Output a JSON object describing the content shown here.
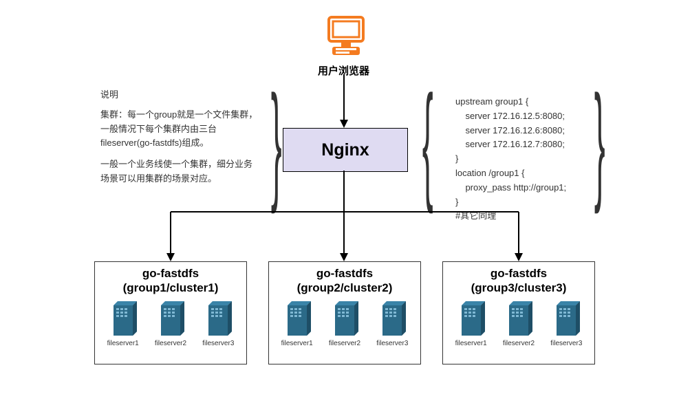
{
  "top": {
    "browser_label": "用户浏览器"
  },
  "nginx": {
    "label": "Nginx"
  },
  "note_left": {
    "title": "说明",
    "p1": "集群：每一个group就是一个文件集群，一般情况下每个集群内由三台fileserver(go-fastdfs)组成。",
    "p2": "一般一个业务线使一个集群，细分业务场景可以用集群的场景对应。"
  },
  "note_right": {
    "line1": "upstream group1 {",
    "line2": "    server 172.16.12.5:8080;",
    "line3": "    server 172.16.12.6:8080;",
    "line4": "    server 172.16.12.7:8080;",
    "line5": "}",
    "line6": "location /group1 {",
    "line7": "    proxy_pass http://group1;",
    "line8": "}",
    "line9": "#其它同理"
  },
  "clusters": [
    {
      "title_l1": "go-fastdfs",
      "title_l2": "(group1/cluster1)",
      "servers": [
        "fileserver1",
        "fileserver2",
        "fileserver3"
      ]
    },
    {
      "title_l1": "go-fastdfs",
      "title_l2": "(group2/cluster2)",
      "servers": [
        "fileserver1",
        "fileserver2",
        "fileserver3"
      ]
    },
    {
      "title_l1": "go-fastdfs",
      "title_l2": "(group3/cluster3)",
      "servers": [
        "fileserver1",
        "fileserver2",
        "fileserver3"
      ]
    }
  ]
}
